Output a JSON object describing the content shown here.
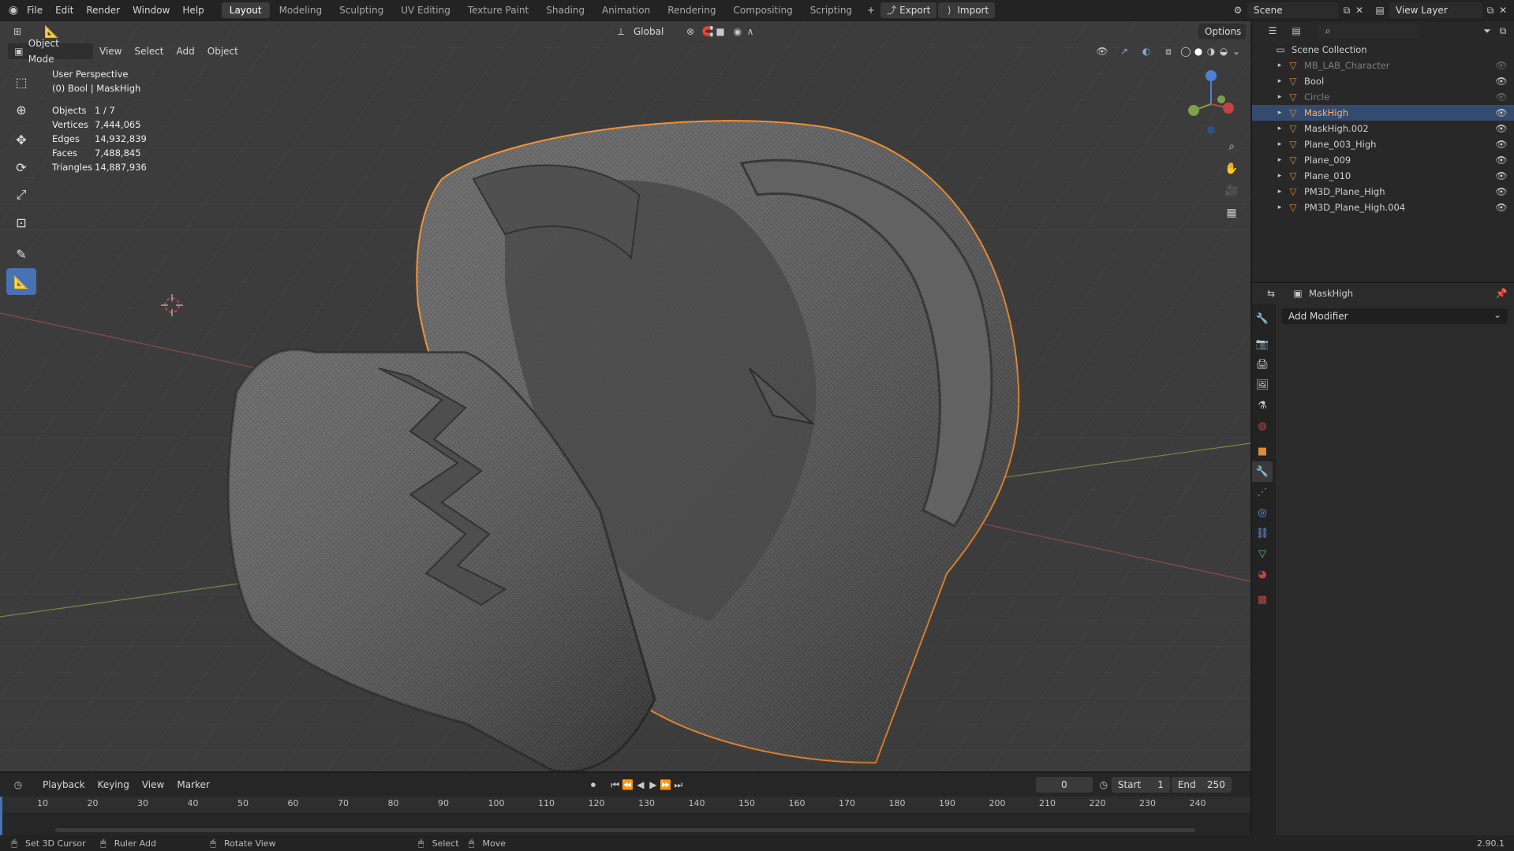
{
  "topbar": {
    "menus": [
      "File",
      "Edit",
      "Render",
      "Window",
      "Help"
    ],
    "workspaces": [
      "Layout",
      "Modeling",
      "Sculpting",
      "UV Editing",
      "Texture Paint",
      "Shading",
      "Animation",
      "Rendering",
      "Compositing",
      "Scripting"
    ],
    "active_workspace": "Layout",
    "export_label": "Export",
    "import_label": "Import",
    "scene_name": "Scene",
    "view_layer": "View Layer"
  },
  "viewport": {
    "mode": "Object Mode",
    "menus": [
      "View",
      "Select",
      "Add",
      "Object"
    ],
    "transform_orientation": "Global",
    "options_label": "Options",
    "perspective": "User Perspective",
    "context": "(0) Bool | MaskHigh",
    "stats": [
      {
        "label": "Objects",
        "value": "1 / 7"
      },
      {
        "label": "Vertices",
        "value": "7,444,065"
      },
      {
        "label": "Edges",
        "value": "14,932,839"
      },
      {
        "label": "Faces",
        "value": "7,488,845"
      },
      {
        "label": "Triangles",
        "value": "14,887,936"
      }
    ]
  },
  "outliner": {
    "root": "Scene Collection",
    "items": [
      {
        "name": "MB_LAB_Character",
        "dim": true
      },
      {
        "name": "Bool",
        "dim": false
      },
      {
        "name": "Circle",
        "dim": true
      },
      {
        "name": "MaskHigh",
        "dim": false,
        "selected": true
      },
      {
        "name": "MaskHigh.002",
        "dim": false
      },
      {
        "name": "Plane_003_High",
        "dim": false
      },
      {
        "name": "Plane_009",
        "dim": false
      },
      {
        "name": "Plane_010",
        "dim": false
      },
      {
        "name": "PM3D_Plane_High",
        "dim": false
      },
      {
        "name": "PM3D_Plane_High.004",
        "dim": false
      }
    ]
  },
  "properties": {
    "object_name": "MaskHigh",
    "add_modifier": "Add Modifier"
  },
  "timeline": {
    "menus": [
      "Playback",
      "Keying",
      "View",
      "Marker"
    ],
    "current_frame": "0",
    "start_label": "Start",
    "start_value": "1",
    "end_label": "End",
    "end_value": "250",
    "ticks": [
      "10",
      "20",
      "30",
      "40",
      "50",
      "60",
      "70",
      "80",
      "90",
      "100",
      "110",
      "120",
      "130",
      "140",
      "150",
      "160",
      "170",
      "180",
      "190",
      "200",
      "210",
      "220",
      "230",
      "240"
    ]
  },
  "statusbar": {
    "hints": [
      "Set 3D Cursor",
      "Ruler Add",
      "Rotate View",
      "Select",
      "Move"
    ],
    "version": "2.90.1"
  },
  "colors": {
    "accent": "#4772b3",
    "selection_outline": "#f28c28",
    "axis_x": "#b04a4a",
    "axis_y": "#7ea04a"
  }
}
